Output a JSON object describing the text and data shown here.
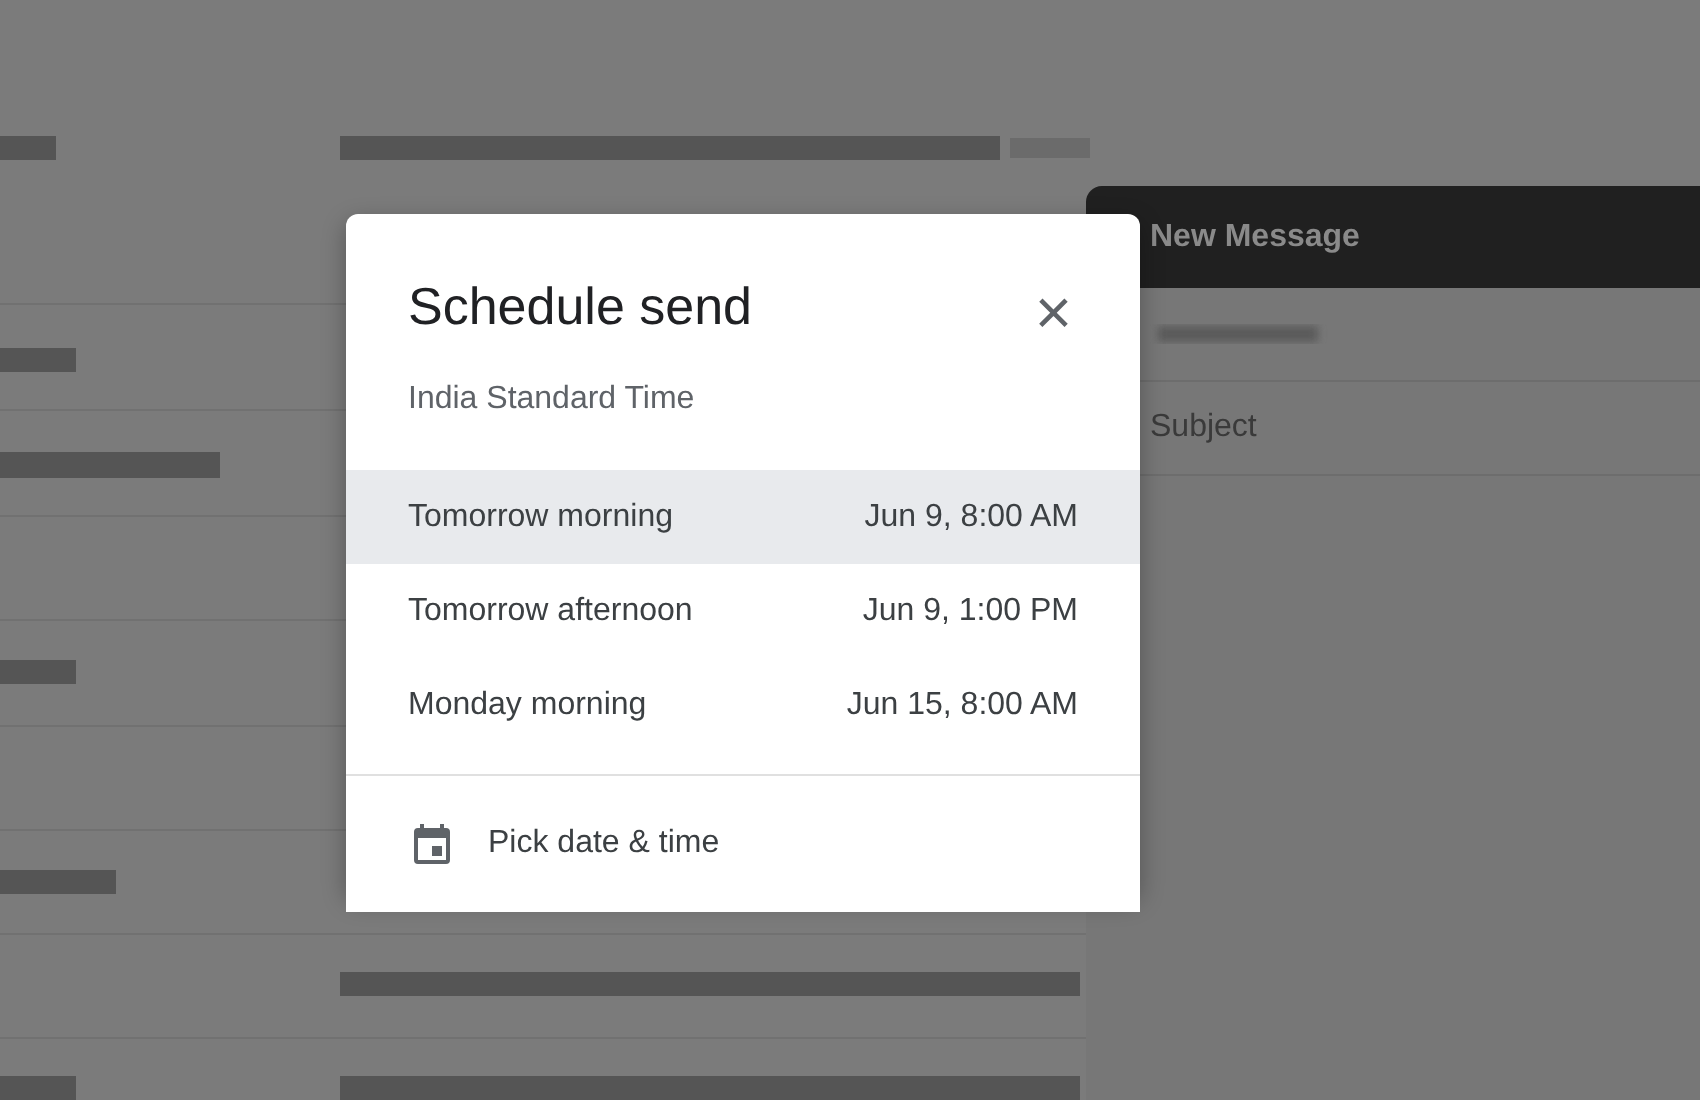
{
  "compose": {
    "title": "New Message",
    "subject_label": "Subject"
  },
  "dialog": {
    "title": "Schedule send",
    "subtitle": "India Standard Time",
    "close": "×",
    "options": [
      {
        "label": "Tomorrow morning",
        "time": "Jun 9, 8:00 AM",
        "selected": true
      },
      {
        "label": "Tomorrow afternoon",
        "time": "Jun 9, 1:00 PM",
        "selected": false
      },
      {
        "label": "Monday morning",
        "time": "Jun 15, 8:00 AM",
        "selected": false
      }
    ],
    "pick": {
      "label": "Pick date & time"
    }
  }
}
